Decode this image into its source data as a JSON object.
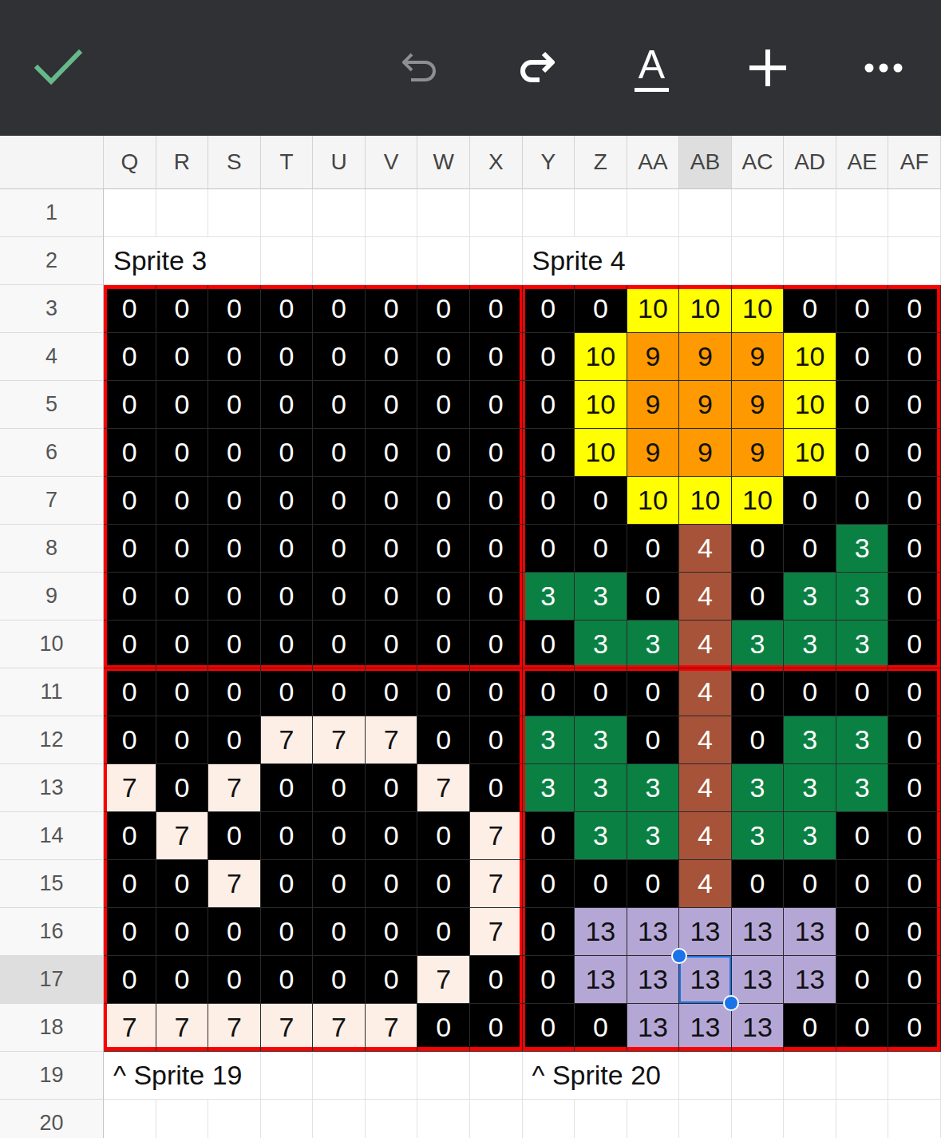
{
  "toolbar": {
    "items": [
      {
        "kind": "confirm",
        "disabled": false
      },
      {
        "kind": "undo",
        "disabled": true
      },
      {
        "kind": "redo",
        "disabled": false
      },
      {
        "kind": "text-format",
        "label": "A",
        "disabled": false
      },
      {
        "kind": "insert",
        "disabled": false
      },
      {
        "kind": "more",
        "disabled": false
      }
    ]
  },
  "sheet": {
    "columns": [
      {
        "label": "Q",
        "selected": false
      },
      {
        "label": "R",
        "selected": false
      },
      {
        "label": "S",
        "selected": false
      },
      {
        "label": "T",
        "selected": false
      },
      {
        "label": "U",
        "selected": false
      },
      {
        "label": "V",
        "selected": false
      },
      {
        "label": "W",
        "selected": false
      },
      {
        "label": "X",
        "selected": false
      },
      {
        "label": "Y",
        "selected": false
      },
      {
        "label": "Z",
        "selected": false
      },
      {
        "label": "AA",
        "selected": false
      },
      {
        "label": "AB",
        "selected": true
      },
      {
        "label": "AC",
        "selected": false
      },
      {
        "label": "AD",
        "selected": false
      },
      {
        "label": "AE",
        "selected": false
      },
      {
        "label": "AF",
        "selected": false
      }
    ],
    "cell_colors": [
      {
        "value": "0",
        "color": "#000000"
      },
      {
        "value": "3",
        "color": "#0b8043"
      },
      {
        "value": "4",
        "color": "#a6533a"
      },
      {
        "value": "7",
        "color": "#fdeee6"
      },
      {
        "value": "9",
        "color": "#ff9900"
      },
      {
        "value": "10",
        "color": "#ffff00"
      },
      {
        "value": "13",
        "color": "#b4a7d6"
      }
    ],
    "rows": [
      {
        "label": "1",
        "selected": false,
        "kind": "label",
        "cells": [
          "",
          "",
          "",
          "",
          "",
          "",
          "",
          "",
          "",
          "",
          "",
          "",
          "",
          "",
          "",
          ""
        ]
      },
      {
        "label": "2",
        "selected": false,
        "kind": "label",
        "cells": [
          "Sprite 3",
          "",
          "",
          "",
          "",
          "",
          "",
          "",
          "Sprite 4",
          "",
          "",
          "",
          "",
          "",
          "",
          ""
        ]
      },
      {
        "label": "3",
        "selected": false,
        "kind": "pixels",
        "cells": [
          "0",
          "0",
          "0",
          "0",
          "0",
          "0",
          "0",
          "0",
          "0",
          "0",
          "10",
          "10",
          "10",
          "0",
          "0",
          "0"
        ]
      },
      {
        "label": "4",
        "selected": false,
        "kind": "pixels",
        "cells": [
          "0",
          "0",
          "0",
          "0",
          "0",
          "0",
          "0",
          "0",
          "0",
          "10",
          "9",
          "9",
          "9",
          "10",
          "0",
          "0"
        ]
      },
      {
        "label": "5",
        "selected": false,
        "kind": "pixels",
        "cells": [
          "0",
          "0",
          "0",
          "0",
          "0",
          "0",
          "0",
          "0",
          "0",
          "10",
          "9",
          "9",
          "9",
          "10",
          "0",
          "0"
        ]
      },
      {
        "label": "6",
        "selected": false,
        "kind": "pixels",
        "cells": [
          "0",
          "0",
          "0",
          "0",
          "0",
          "0",
          "0",
          "0",
          "0",
          "10",
          "9",
          "9",
          "9",
          "10",
          "0",
          "0"
        ]
      },
      {
        "label": "7",
        "selected": false,
        "kind": "pixels",
        "cells": [
          "0",
          "0",
          "0",
          "0",
          "0",
          "0",
          "0",
          "0",
          "0",
          "0",
          "10",
          "10",
          "10",
          "0",
          "0",
          "0"
        ]
      },
      {
        "label": "8",
        "selected": false,
        "kind": "pixels",
        "cells": [
          "0",
          "0",
          "0",
          "0",
          "0",
          "0",
          "0",
          "0",
          "0",
          "0",
          "0",
          "4",
          "0",
          "0",
          "3",
          "0"
        ]
      },
      {
        "label": "9",
        "selected": false,
        "kind": "pixels",
        "cells": [
          "0",
          "0",
          "0",
          "0",
          "0",
          "0",
          "0",
          "0",
          "3",
          "3",
          "0",
          "4",
          "0",
          "3",
          "3",
          "0"
        ]
      },
      {
        "label": "10",
        "selected": false,
        "kind": "pixels",
        "cells": [
          "0",
          "0",
          "0",
          "0",
          "0",
          "0",
          "0",
          "0",
          "0",
          "3",
          "3",
          "4",
          "3",
          "3",
          "3",
          "0"
        ]
      },
      {
        "label": "11",
        "selected": false,
        "kind": "pixels",
        "cells": [
          "0",
          "0",
          "0",
          "0",
          "0",
          "0",
          "0",
          "0",
          "0",
          "0",
          "0",
          "4",
          "0",
          "0",
          "0",
          "0"
        ]
      },
      {
        "label": "12",
        "selected": false,
        "kind": "pixels",
        "cells": [
          "0",
          "0",
          "0",
          "7",
          "7",
          "7",
          "0",
          "0",
          "3",
          "3",
          "0",
          "4",
          "0",
          "3",
          "3",
          "0"
        ]
      },
      {
        "label": "13",
        "selected": false,
        "kind": "pixels",
        "cells": [
          "7",
          "0",
          "7",
          "0",
          "0",
          "0",
          "7",
          "0",
          "3",
          "3",
          "3",
          "4",
          "3",
          "3",
          "3",
          "0"
        ]
      },
      {
        "label": "14",
        "selected": false,
        "kind": "pixels",
        "cells": [
          "0",
          "7",
          "0",
          "0",
          "0",
          "0",
          "0",
          "7",
          "0",
          "3",
          "3",
          "4",
          "3",
          "3",
          "0",
          "0"
        ]
      },
      {
        "label": "15",
        "selected": false,
        "kind": "pixels",
        "cells": [
          "0",
          "0",
          "7",
          "0",
          "0",
          "0",
          "0",
          "7",
          "0",
          "0",
          "0",
          "4",
          "0",
          "0",
          "0",
          "0"
        ]
      },
      {
        "label": "16",
        "selected": false,
        "kind": "pixels",
        "cells": [
          "0",
          "0",
          "0",
          "0",
          "0",
          "0",
          "0",
          "7",
          "0",
          "13",
          "13",
          "13",
          "13",
          "13",
          "0",
          "0"
        ]
      },
      {
        "label": "17",
        "selected": true,
        "kind": "pixels",
        "cells": [
          "0",
          "0",
          "0",
          "0",
          "0",
          "0",
          "7",
          "0",
          "0",
          "13",
          "13",
          "13",
          "13",
          "13",
          "0",
          "0"
        ]
      },
      {
        "label": "18",
        "selected": false,
        "kind": "pixels",
        "cells": [
          "7",
          "7",
          "7",
          "7",
          "7",
          "7",
          "0",
          "0",
          "0",
          "0",
          "13",
          "13",
          "13",
          "0",
          "0",
          "0"
        ]
      },
      {
        "label": "19",
        "selected": false,
        "kind": "label",
        "cells": [
          "^ Sprite 19",
          "",
          "",
          "",
          "",
          "",
          "",
          "",
          "^ Sprite 20",
          "",
          "",
          "",
          "",
          "",
          "",
          ""
        ]
      },
      {
        "label": "20",
        "selected": false,
        "kind": "label",
        "cells": [
          "",
          "",
          "",
          "",
          "",
          "",
          "",
          "",
          "",
          "",
          "",
          "",
          "",
          "",
          "",
          ""
        ]
      }
    ]
  }
}
